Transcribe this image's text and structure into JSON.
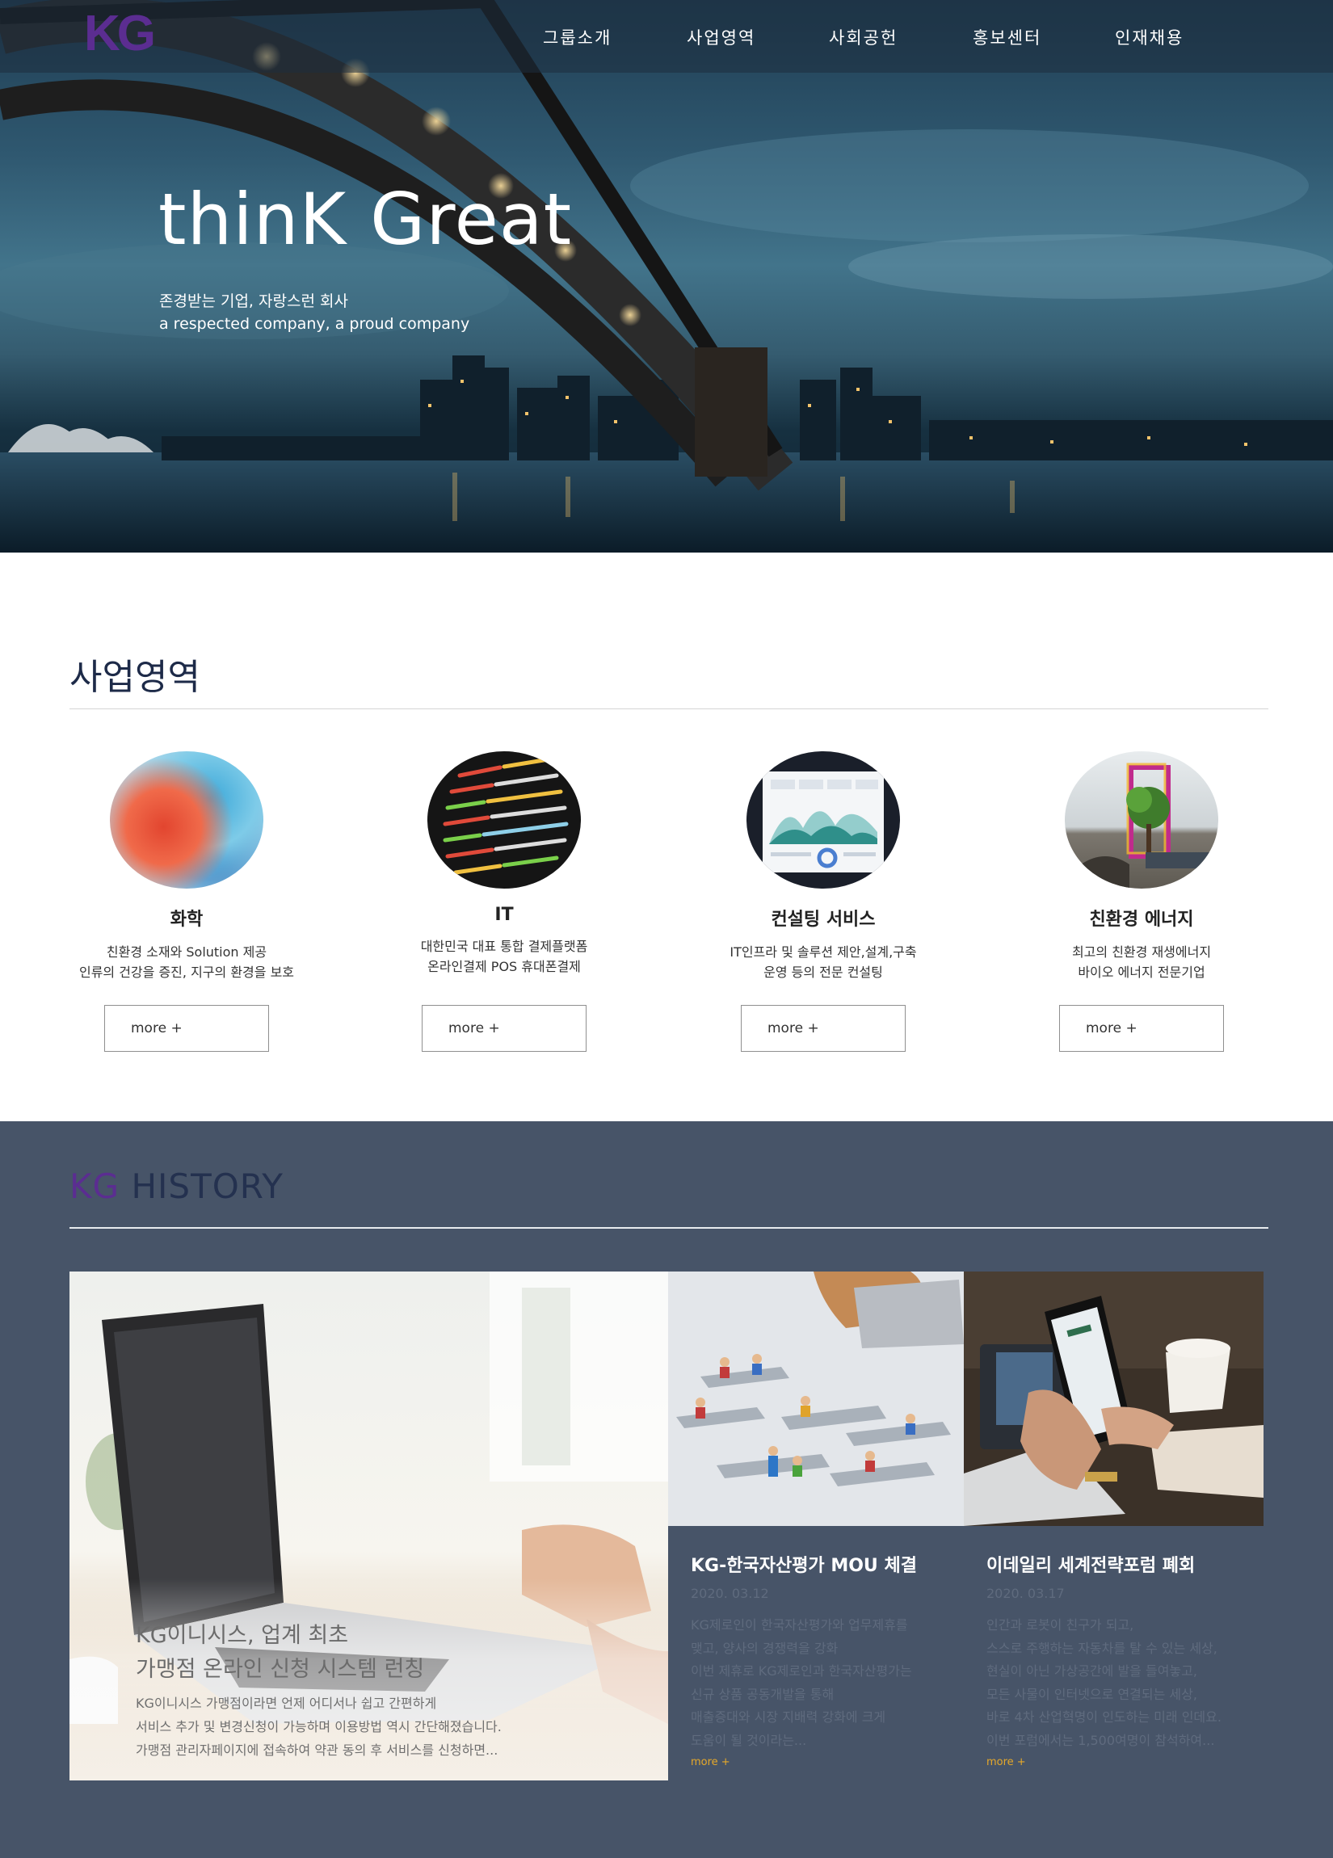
{
  "header": {
    "logo_text": "KG",
    "nav": [
      "그룹소개",
      "사업영역",
      "사회공헌",
      "홍보센터",
      "인재채용"
    ]
  },
  "hero": {
    "title": "thinK Great",
    "subtitle_ko": "존경받는 기업, 자랑스런 회사",
    "subtitle_en": "a respected company, a proud company"
  },
  "business": {
    "title": "사업영역",
    "more_label": "more +",
    "items": [
      {
        "name": "화학",
        "desc": [
          "친환경 소재와 Solution 제공",
          "인류의 건강을 증진, 지구의 환경을 보호"
        ]
      },
      {
        "name": "IT",
        "desc": [
          "대한민국 대표 통합 결제플랫폼",
          "온라인결제 POS 휴대폰결제"
        ]
      },
      {
        "name": "컨설팅 서비스",
        "desc": [
          "IT인프라 및 솔루션 제안,설계,구축",
          "운영 등의 전문 컨설팅"
        ]
      },
      {
        "name": "친환경 에너지",
        "desc": [
          "최고의 친환경 재생에너지",
          "바이오 에너지 전문기업"
        ]
      }
    ]
  },
  "history": {
    "title_kg": "KG",
    "title_rest": "HISTORY",
    "featured": {
      "headline": [
        "KG이니시스, 업계 최초",
        "가맹점 온라인 신청 시스템 런칭"
      ],
      "body": [
        "KG이니시스 가맹점이라면 언제 어디서나 쉽고 간편하게",
        "서비스 추가 및 변경신청이 가능하며 이용방법 역시 간단해졌습니다.",
        "가맹점 관리자페이지에 접속하여 약관 동의 후 서비스를 신청하면..."
      ]
    },
    "news": [
      {
        "title": "KG-한국자산평가 MOU 체결",
        "date": "2020. 03.12",
        "body": [
          "KG제로인이 한국자산평가와 업무제휴를",
          "맺고, 양사의 경쟁력을 강화",
          "이번 제휴로 KG제로인과 한국자산평가는",
          "신규 상품 공동개발을 통해",
          "매출증대와 시장 지배력 강화에 크게",
          "도움이 될 것이라는..."
        ],
        "more": "more +"
      },
      {
        "title": "이데일리 세계전략포럼 폐회",
        "date": "2020. 03.17",
        "body": [
          "인간과 로봇이 친구가 되고,",
          "스스로 주행하는 자동차를 탈 수 있는 세상,",
          "현실이 아닌 가상공간에 발을 들여놓고,",
          "모든 사물이 인터넷으로 연결되는 세상,",
          "바로 4차 산업혁명이 인도하는 미래 인데요.",
          "이번 포럼에서는 1,500여명이 참석하여..."
        ],
        "more": "more +"
      }
    ]
  },
  "colors": {
    "brand_purple": "#5b2d91",
    "history_bg": "#475468",
    "more_accent": "#e6a92a",
    "title_navy": "#1d2a48"
  }
}
